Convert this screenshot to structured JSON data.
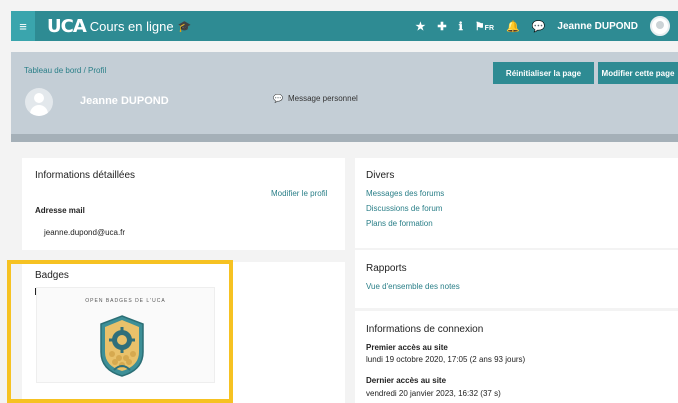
{
  "topbar": {
    "menu_icon": "hamburger-icon",
    "logo": "UCA",
    "site_name": "Cours en ligne",
    "icons": [
      "star-icon",
      "plus-icon",
      "info-icon",
      "flag-icon",
      "bell-icon",
      "chat-icon"
    ],
    "lang": "FR",
    "user_name": "Jeanne DUPOND"
  },
  "header": {
    "breadcrumb": "Tableau de bord  /  Profil",
    "name": "Jeanne DUPOND",
    "message_link": "Message personnel",
    "reset_button": "Réinitialiser la page",
    "edit_button": "Modifier cette page"
  },
  "info": {
    "title": "Informations détaillées",
    "edit_profile": "Modifier le profil",
    "email_label": "Adresse mail",
    "email": "jeanne.dupond@uca.fr"
  },
  "badges": {
    "title": "Badges",
    "badge_tag": "OPEN BADGES DE L'UCA"
  },
  "divers": {
    "title": "Divers",
    "links": [
      "Messages des forums",
      "Discussions de forum",
      "Plans de formation"
    ]
  },
  "rapports": {
    "title": "Rapports",
    "links": [
      "Vue d'ensemble des notes"
    ]
  },
  "connexion": {
    "title": "Informations de connexion",
    "first_label": "Premier accès au site",
    "first_value": "lundi 19 octobre 2020, 17:05  (2 ans 93 jours)",
    "last_label": "Dernier accès au site",
    "last_value": "vendredi 20 janvier 2023, 16:32  (37 s)"
  },
  "colors": {
    "primary": "#2e8b93",
    "highlight": "#f6c222"
  }
}
